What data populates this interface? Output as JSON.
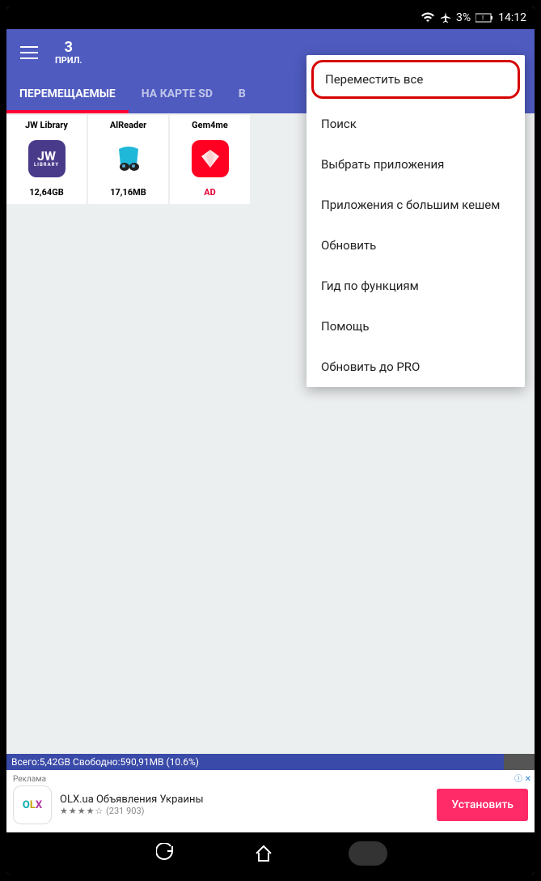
{
  "status_bar": {
    "battery": "3%",
    "time": "14:12"
  },
  "app_bar": {
    "count": "3",
    "count_label": "ПРИЛ."
  },
  "tabs": {
    "movable": "ПЕРЕМЕЩАЕМЫЕ",
    "sd": "НА КАРТЕ SD",
    "partial": "В"
  },
  "apps": [
    {
      "name": "JW Library",
      "size": "12,64GB"
    },
    {
      "name": "AlReader",
      "size": "17,16MB"
    },
    {
      "name": "Gem4me",
      "size": "AD"
    }
  ],
  "menu": {
    "move_all": "Переместить все",
    "search": "Поиск",
    "select_apps": "Выбрать приложения",
    "big_cache": "Приложения с большим кешем",
    "refresh": "Обновить",
    "guide": "Гид по функциям",
    "help": "Помощь",
    "upgrade": "Обновить до PRO"
  },
  "storage": {
    "line": "Всего:5,42GB Свободно:590,91MB (10.6%)"
  },
  "ad": {
    "label": "Реклама",
    "title": "OLX.ua Объявления Украины",
    "reviews": "(231 903)",
    "button": "Установить",
    "corner": "i"
  }
}
